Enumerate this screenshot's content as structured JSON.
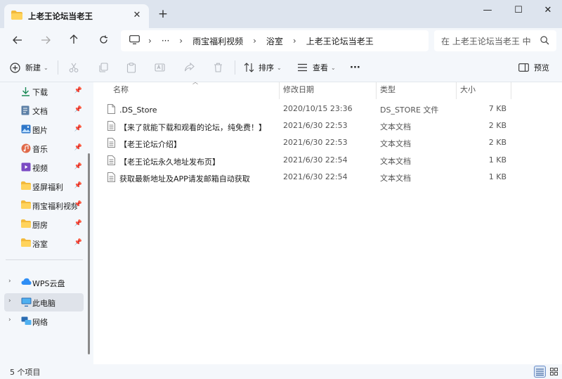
{
  "tab": {
    "title": "上老王论坛当老王",
    "close": "✕",
    "new": "+"
  },
  "window": {
    "minimize": "—",
    "maximize": "☐",
    "close": "✕"
  },
  "address": {
    "ellipsis": "···",
    "segments": [
      "雨宝福利视频",
      "浴室",
      "上老王论坛当老王"
    ],
    "separator": "›"
  },
  "search": {
    "placeholder": "在 上老王论坛当老王 中"
  },
  "toolbar": {
    "new_label": "新建",
    "sort_label": "排序",
    "view_label": "查看",
    "more": "···",
    "preview_label": "预览"
  },
  "sidebar": {
    "items": [
      {
        "label": "下载",
        "icon": "download-icon",
        "pinned": true
      },
      {
        "label": "文档",
        "icon": "document-icon",
        "pinned": true
      },
      {
        "label": "图片",
        "icon": "picture-icon",
        "pinned": true
      },
      {
        "label": "音乐",
        "icon": "music-icon",
        "pinned": true
      },
      {
        "label": "视频",
        "icon": "video-icon",
        "pinned": true
      },
      {
        "label": "竖屏福利",
        "icon": "folder-icon",
        "pinned": true
      },
      {
        "label": "雨宝福利视频",
        "icon": "folder-icon",
        "pinned": true
      },
      {
        "label": "厨房",
        "icon": "folder-icon",
        "pinned": true
      },
      {
        "label": "浴室",
        "icon": "folder-icon",
        "pinned": true
      }
    ],
    "locations": [
      {
        "label": "WPS云盘",
        "icon": "cloud-icon"
      },
      {
        "label": "此电脑",
        "icon": "computer-icon",
        "selected": true
      },
      {
        "label": "网络",
        "icon": "network-icon"
      }
    ]
  },
  "columns": {
    "name": "名称",
    "date": "修改日期",
    "type": "类型",
    "size": "大小"
  },
  "files": [
    {
      "name": ".DS_Store",
      "date": "2020/10/15 23:36",
      "type": "DS_STORE 文件",
      "size": "7 KB",
      "icon": "blank-file-icon"
    },
    {
      "name": "【来了就能下载和观看的论坛，纯免费！】",
      "date": "2021/6/30 22:53",
      "type": "文本文档",
      "size": "2 KB",
      "icon": "text-file-icon"
    },
    {
      "name": "【老王论坛介绍】",
      "date": "2021/6/30 22:53",
      "type": "文本文档",
      "size": "2 KB",
      "icon": "text-file-icon"
    },
    {
      "name": "【老王论坛永久地址发布页】",
      "date": "2021/6/30 22:54",
      "type": "文本文档",
      "size": "1 KB",
      "icon": "text-file-icon"
    },
    {
      "name": "获取最新地址及APP请发邮箱自动获取",
      "date": "2021/6/30 22:54",
      "type": "文本文档",
      "size": "1 KB",
      "icon": "text-file-icon"
    }
  ],
  "status": {
    "count": "5 个项目"
  },
  "colors": {
    "accent": "#0067c0",
    "folder": "#f4c54c",
    "selection": "#dfe3ea",
    "titlebar": "#dde4ee"
  }
}
